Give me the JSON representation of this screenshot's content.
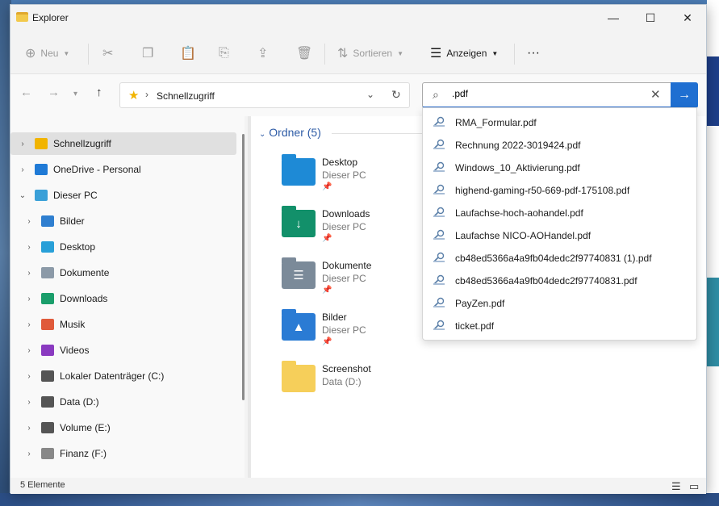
{
  "window": {
    "title": "Explorer"
  },
  "toolbar": {
    "new_label": "Neu",
    "sort_label": "Sortieren",
    "view_label": "Anzeigen",
    "more_label": "···"
  },
  "address": {
    "path": "Schnellzugriff"
  },
  "search": {
    "value": ".pdf"
  },
  "sidebar": {
    "items": [
      {
        "label": "Schnellzugriff",
        "icon": "star-icon",
        "color": "#f1b400",
        "level": 0,
        "selected": true
      },
      {
        "label": "OneDrive - Personal",
        "icon": "cloud-icon",
        "color": "#1f7ad6",
        "level": 0
      },
      {
        "label": "Dieser PC",
        "icon": "computer-icon",
        "color": "#3aa0d8",
        "level": 0,
        "expanded": true
      },
      {
        "label": "Bilder",
        "icon": "pictures-icon",
        "color": "#2f7fd0",
        "level": 1
      },
      {
        "label": "Desktop",
        "icon": "desktop-icon",
        "color": "#28a0d8",
        "level": 1
      },
      {
        "label": "Dokumente",
        "icon": "documents-icon",
        "color": "#8c9aa8",
        "level": 1
      },
      {
        "label": "Downloads",
        "icon": "downloads-icon",
        "color": "#1a9e6b",
        "level": 1
      },
      {
        "label": "Musik",
        "icon": "music-icon",
        "color": "#e05a3a",
        "level": 1
      },
      {
        "label": "Videos",
        "icon": "videos-icon",
        "color": "#8a3ac0",
        "level": 1
      },
      {
        "label": "Lokaler Datenträger (C:)",
        "icon": "drive-c-icon",
        "color": "#555555",
        "level": 1
      },
      {
        "label": "Data (D:)",
        "icon": "drive-icon",
        "color": "#555555",
        "level": 1
      },
      {
        "label": "Volume (E:)",
        "icon": "drive-icon",
        "color": "#555555",
        "level": 1
      },
      {
        "label": "Finanz (F:)",
        "icon": "drive-icon",
        "color": "#888888",
        "level": 1
      }
    ]
  },
  "content": {
    "group_title": "Ordner (5)",
    "folders": [
      {
        "name": "Desktop",
        "location": "Dieser PC",
        "icon": "desktop-folder-icon",
        "color": "#1e8ad6",
        "glyph": "",
        "pinned": true
      },
      {
        "name": "Downloads",
        "location": "Dieser PC",
        "icon": "downloads-folder-icon",
        "color": "#12906a",
        "glyph": "↓",
        "pinned": true
      },
      {
        "name": "Dokumente",
        "location": "Dieser PC",
        "icon": "documents-folder-icon",
        "color": "#7b8a99",
        "glyph": "☰",
        "pinned": true
      },
      {
        "name": "Bilder",
        "location": "Dieser PC",
        "icon": "pictures-folder-icon",
        "color": "#2a7bd4",
        "glyph": "▲",
        "pinned": true
      },
      {
        "name": "Screenshot",
        "location": "Data (D:)",
        "icon": "folder-icon",
        "color": "#f6cf5a",
        "glyph": "",
        "pinned": false
      }
    ]
  },
  "suggestions": [
    "RMA_Formular.pdf",
    "Rechnung 2022-3019424.pdf",
    "Windows_10_Aktivierung.pdf",
    "highend-gaming-r50-669-pdf-175108.pdf",
    "Laufachse-hoch-aohandel.pdf",
    "Laufachse NICO-AOHandel.pdf",
    "cb48ed5366a4a9fb04dedc2f97740831 (1).pdf",
    "cb48ed5366a4a9fb04dedc2f97740831.pdf",
    "PayZen.pdf",
    "ticket.pdf"
  ],
  "status": {
    "count": "5 Elemente"
  }
}
